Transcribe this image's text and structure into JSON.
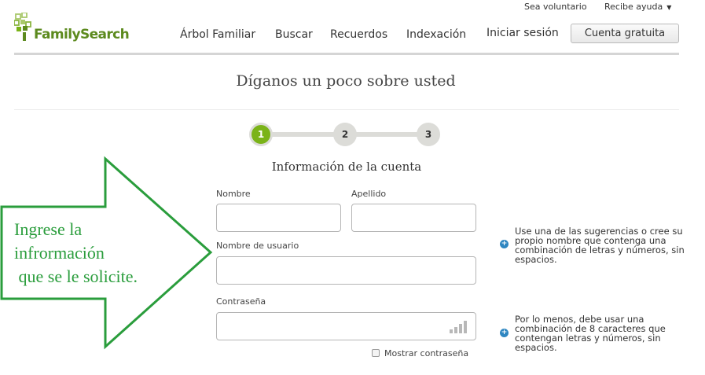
{
  "top_links": {
    "volunteer": "Sea voluntario",
    "help": "Recibe ayuda",
    "help_caret": "▼"
  },
  "logo": {
    "text": "FamilySearch",
    "icon": "tree-squares-icon",
    "brand_color": "#5c8a1e"
  },
  "nav": {
    "arbol": "Árbol Familiar",
    "buscar": "Buscar",
    "recuerdos": "Recuerdos",
    "indexacion": "Indexación",
    "login": "Iniciar sesión",
    "free_account": "Cuenta gratuita"
  },
  "page": {
    "title": "Díganos un poco sobre usted",
    "section_title": "Información de la cuenta"
  },
  "stepper": {
    "steps": [
      "1",
      "2",
      "3"
    ],
    "current": 1,
    "active_color": "#7ab318"
  },
  "form": {
    "first_name_label": "Nombre",
    "last_name_label": "Apellido",
    "username_label": "Nombre de usuario",
    "password_label": "Contraseña",
    "show_password_label": "Mostrar contraseña",
    "first_name_value": "",
    "last_name_value": "",
    "username_value": "",
    "password_value": ""
  },
  "hints": {
    "username": "Use una de las sugerencias o cree su propio nombre que contenga una combinación de letras y números, sin espacios.",
    "password": "Por lo menos, debe usar una combinación de 8 caracteres que contengan letras y números, sin espacios.",
    "icon": "info-circle-icon",
    "icon_color": "#2e86c1"
  },
  "annotation": {
    "text": "Ingrese la\ninfrormación\n que se le solicite.",
    "color": "#2a9d3c"
  }
}
